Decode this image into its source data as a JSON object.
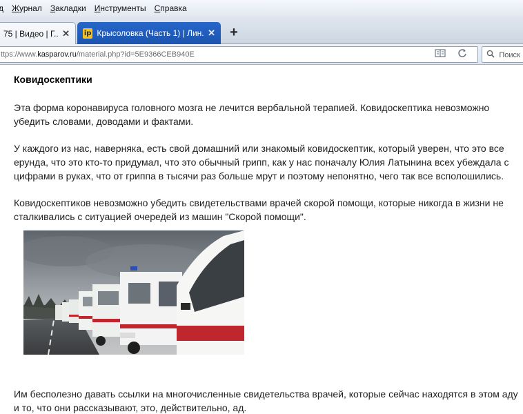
{
  "menu": {
    "items": [
      {
        "label": "д"
      },
      {
        "label": "Журнал",
        "accel": "Ж",
        "rest": "урнал"
      },
      {
        "label": "Закладки",
        "accel": "З",
        "rest": "акладки"
      },
      {
        "label": "Инструменты",
        "accel": "И",
        "rest": "нструменты"
      },
      {
        "label": "Справка",
        "accel": "С",
        "rest": "правка"
      }
    ]
  },
  "tabs": [
    {
      "title": "75 | Видео | Г..."
    },
    {
      "title": "Крысоловка (Часть 1) | Лин...",
      "favicon": "ip"
    }
  ],
  "navbar": {
    "url_prefix": "ttps://www.",
    "url_host": "kasparov.ru",
    "url_rest": "/material.php?id=5E9366CEB940E",
    "search_placeholder": "Поиск"
  },
  "article": {
    "heading": "Ковидоскептики",
    "paragraphs": [
      "Эта форма коронавируса головного мозга не лечится вербальной терапией. Ковидоскептика невозможно убедить словами, доводами и фактами.",
      "У каждого из нас, наверняка, есть свой домашний или знакомый ковидоскептик, который уверен, что это все ерунда, что это кто-то придумал, что это обычный грипп, как у нас поначалу Юлия Латынина всех убеждала с цифрами в руках, что от гриппа в тысячи раз больше мрут и поэтому непонятно,  чего так все всполошились.",
      "Ковидоскептиков невозможно убедить свидетельствами врачей скорой помощи, которые никогда в жизни не сталкивались с ситуацией очередей из машин \"Скорой помощи\".",
      "Им бесполезно давать ссылки на многочисленные свидетельства врачей, которые сейчас находятся в этом аду и то, что они рассказывают, это, действительно, ад."
    ]
  },
  "colors": {
    "ambulance_stripe": "#c0262e",
    "ambulance_body": "#eef0ee",
    "sky": "#8a9097"
  }
}
